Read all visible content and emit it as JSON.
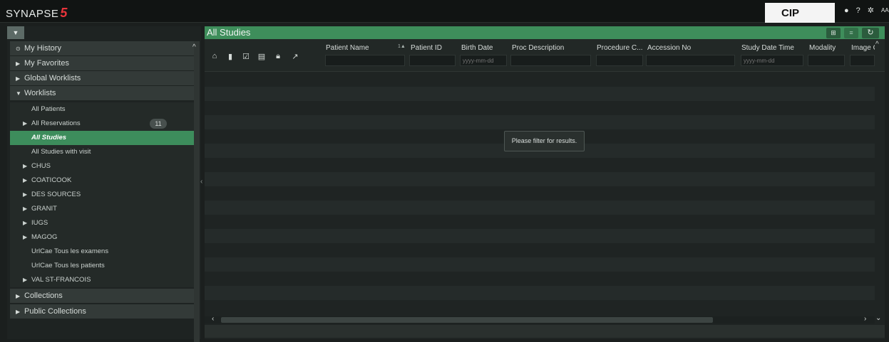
{
  "app": {
    "logo_text": "SYNAPSE",
    "logo_mark": "5",
    "cip": "CIP"
  },
  "top_icons": [
    {
      "icon": "chat-icon",
      "glyph": "●"
    },
    {
      "icon": "help-icon",
      "glyph": "?"
    },
    {
      "icon": "gear-icon",
      "glyph": "✲"
    },
    {
      "icon": "font-size-icon",
      "glyph": "AA"
    }
  ],
  "sidebar": {
    "sections": [
      {
        "label": "My History",
        "icon": "clock-icon",
        "glyph": "⊙"
      },
      {
        "label": "My Favorites",
        "glyph": "▶"
      },
      {
        "label": "Global Worklists",
        "glyph": "▶"
      },
      {
        "label": "Worklists",
        "glyph": "▼"
      }
    ],
    "worklist_items": [
      {
        "label": "All Patients",
        "glyph": ""
      },
      {
        "label": "All Reservations",
        "glyph": "▶",
        "badge": "11"
      },
      {
        "label": "All Studies",
        "glyph": ""
      },
      {
        "label": "All Studies with visit",
        "glyph": ""
      },
      {
        "label": "CHUS",
        "glyph": "▶"
      },
      {
        "label": "COATICOOK",
        "glyph": "▶"
      },
      {
        "label": "DES SOURCES",
        "glyph": "▶"
      },
      {
        "label": "GRANIT",
        "glyph": "▶"
      },
      {
        "label": "IUGS",
        "glyph": "▶"
      },
      {
        "label": "MAGOG",
        "glyph": "▶"
      },
      {
        "label": "UrlCae Tous les examens",
        "glyph": ""
      },
      {
        "label": "UrlCae Tous les patients",
        "glyph": ""
      },
      {
        "label": "VAL ST-FRANCOIS",
        "glyph": "▶"
      }
    ],
    "bottom_sections": [
      {
        "label": "Collections",
        "glyph": "▶"
      },
      {
        "label": "Public Collections",
        "glyph": "▶"
      }
    ],
    "active": "All Studies"
  },
  "main": {
    "title": "All Studies",
    "toolbar_icons": [
      {
        "icon": "home-icon",
        "glyph": "⌂"
      },
      {
        "icon": "document-icon",
        "glyph": "▮"
      },
      {
        "icon": "edit-icon",
        "glyph": "☑"
      },
      {
        "icon": "report-icon",
        "glyph": "▤"
      },
      {
        "icon": "lock-icon",
        "glyph": "🔒︎"
      },
      {
        "icon": "pin-icon",
        "glyph": "↗"
      }
    ],
    "columns": [
      {
        "label": "Patient Name",
        "placeholder": ""
      },
      {
        "label": "Patient ID",
        "placeholder": ""
      },
      {
        "label": "Birth Date",
        "placeholder": "yyyy-mm-dd"
      },
      {
        "label": "Proc Description",
        "placeholder": ""
      },
      {
        "label": "Procedure C...",
        "placeholder": ""
      },
      {
        "label": "Accession No",
        "placeholder": ""
      },
      {
        "label": "Study Date Time",
        "placeholder": "yyyy-mm-dd"
      },
      {
        "label": "Modality",
        "placeholder": ""
      },
      {
        "label": "Image C",
        "placeholder": ""
      }
    ],
    "sort_indicator": "1▲",
    "empty_message": "Please filter for results."
  },
  "colors": {
    "accent": "#3e8e5b",
    "active_item": "#3d8d5c",
    "background": "#1b1f1e"
  }
}
